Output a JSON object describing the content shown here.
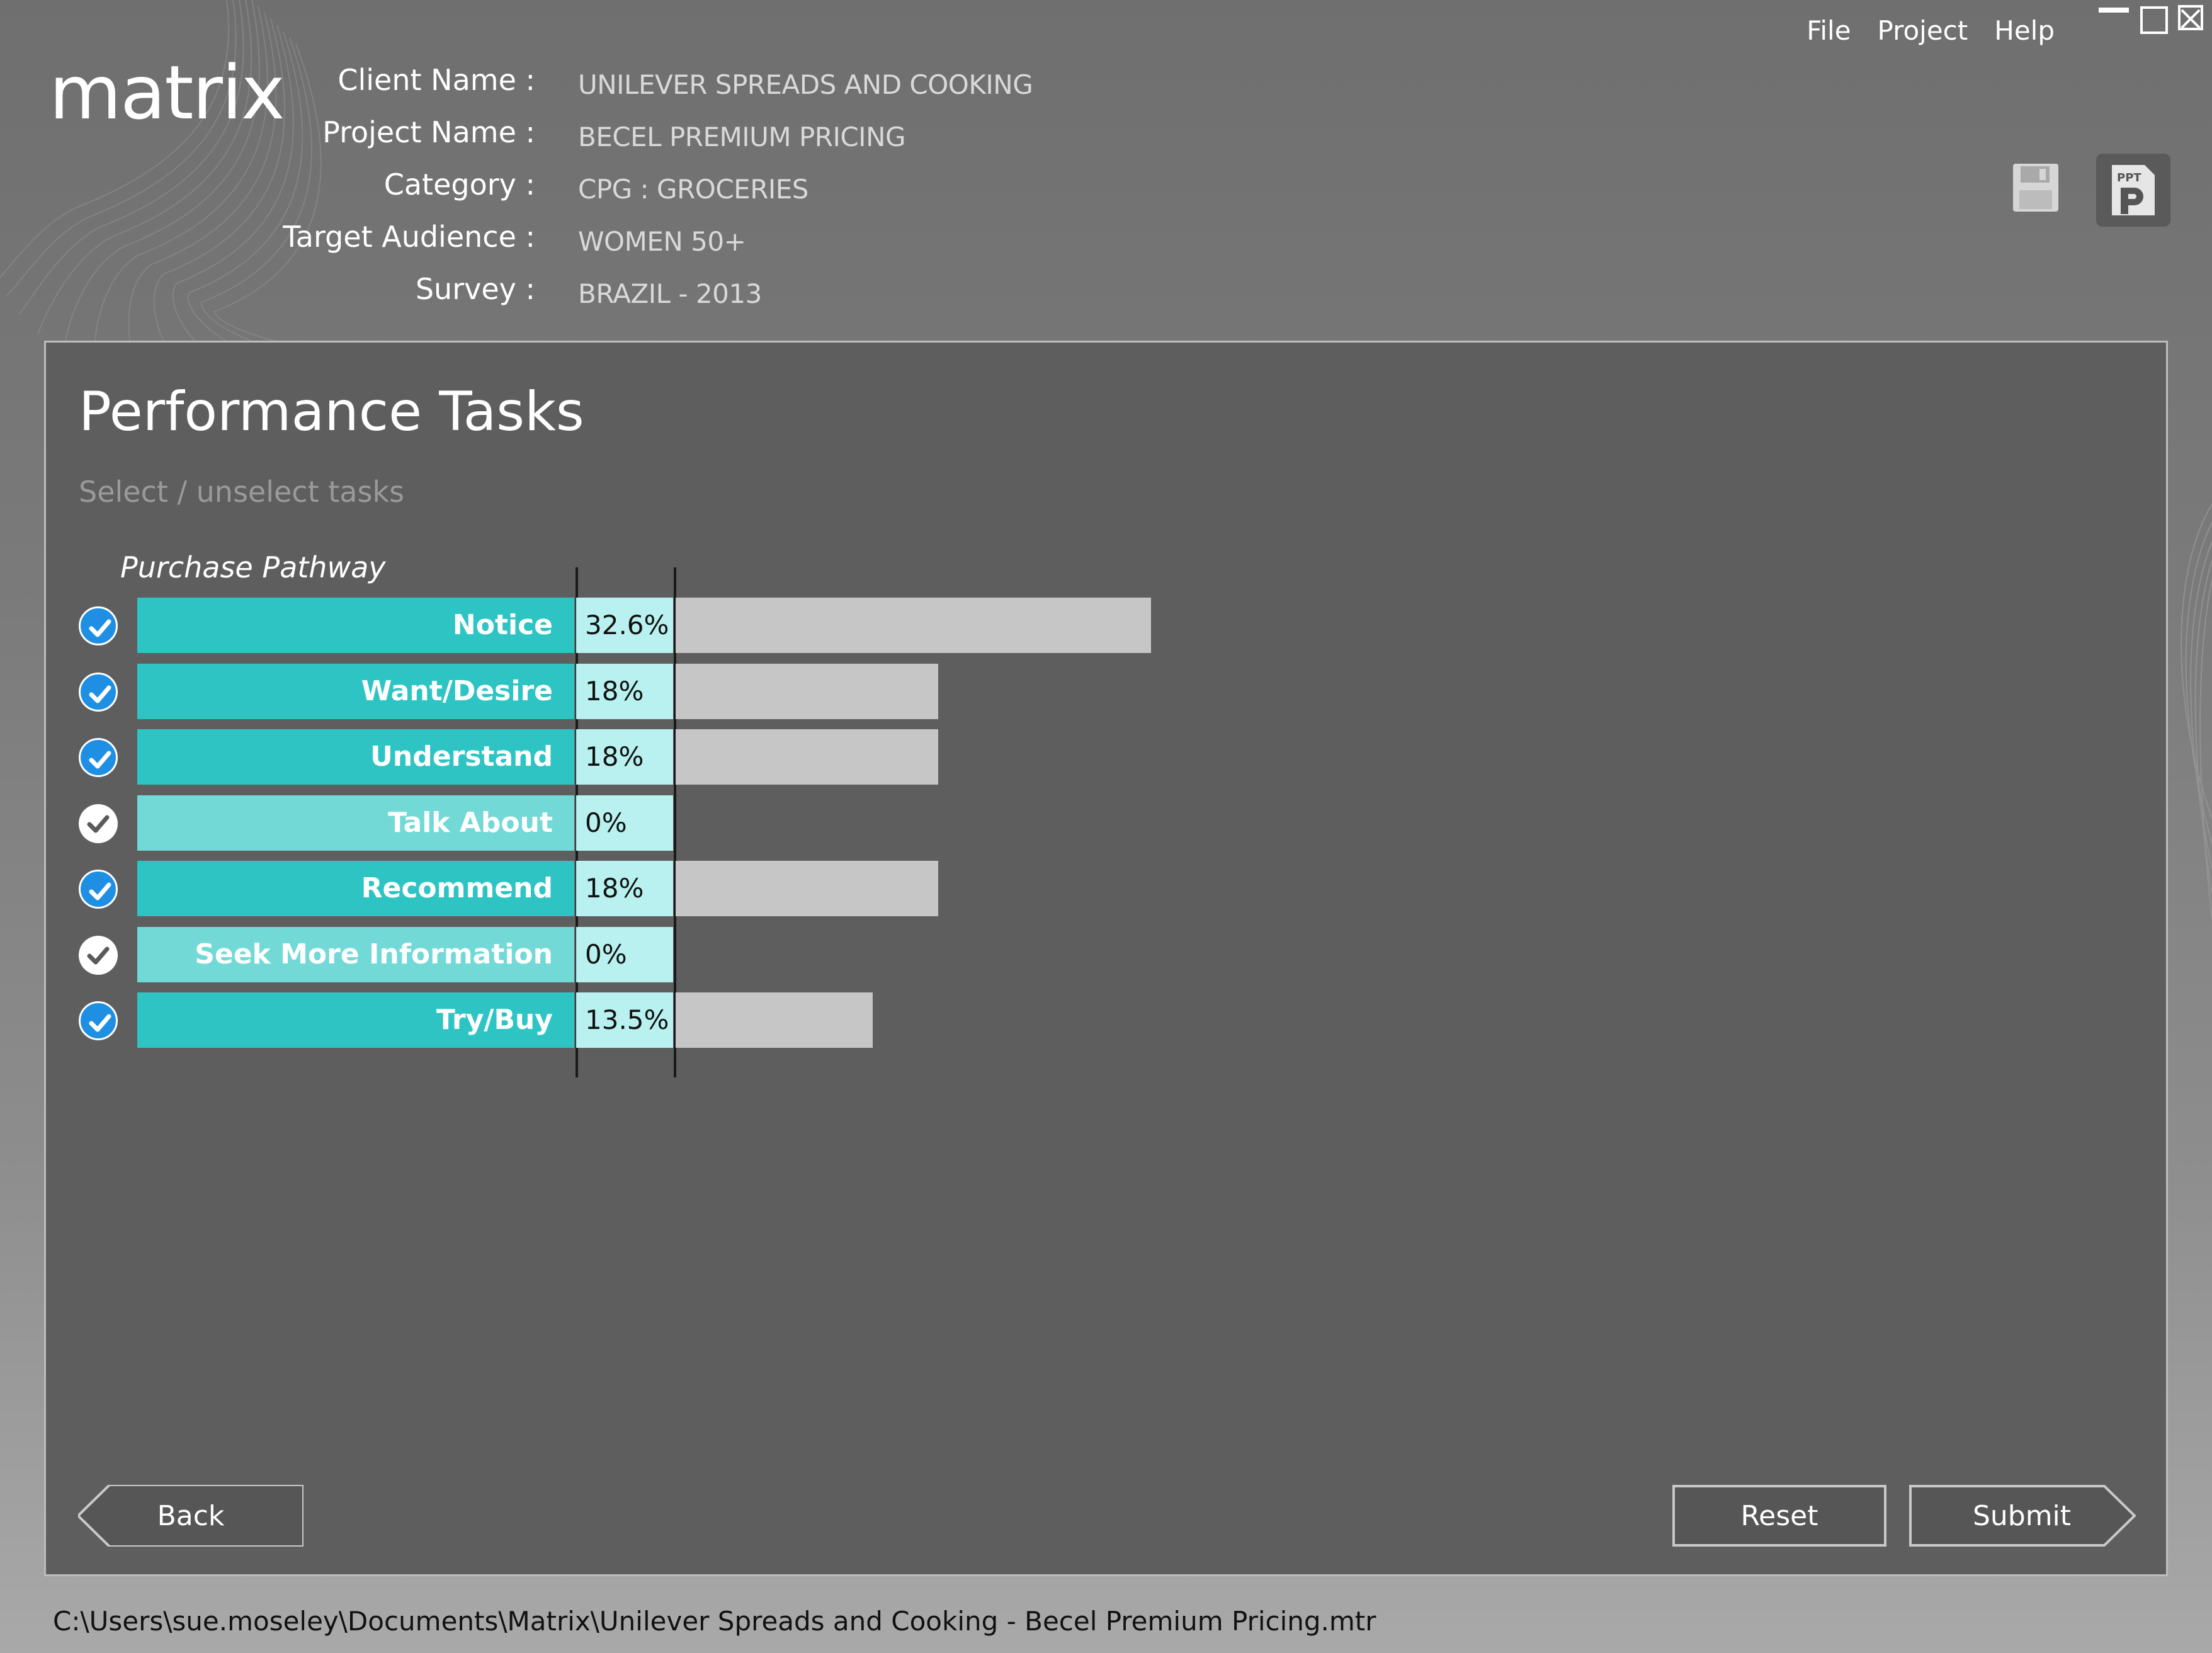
{
  "app": {
    "logo": "matrix"
  },
  "menu": {
    "file": "File",
    "project": "Project",
    "help": "Help"
  },
  "info": [
    {
      "label": "Client Name :",
      "value": "UNILEVER SPREADS AND COOKING"
    },
    {
      "label": "Project Name :",
      "value": "BECEL PREMIUM PRICING"
    },
    {
      "label": "Category :",
      "value": "CPG : GROCERIES"
    },
    {
      "label": "Target Audience :",
      "value": "WOMEN 50+"
    },
    {
      "label": "Survey :",
      "value": "BRAZIL - 2013"
    }
  ],
  "panel": {
    "title": "Performance Tasks",
    "subtitle": "Select / unselect tasks",
    "group": "Purchase Pathway"
  },
  "tasks": [
    {
      "label": "Notice",
      "pct": "32.6%",
      "value": 32.6,
      "selected": true
    },
    {
      "label": "Want/Desire",
      "pct": "18%",
      "value": 18,
      "selected": true
    },
    {
      "label": "Understand",
      "pct": "18%",
      "value": 18,
      "selected": true
    },
    {
      "label": "Talk About",
      "pct": "0%",
      "value": 0,
      "selected": false
    },
    {
      "label": "Recommend",
      "pct": "18%",
      "value": 18,
      "selected": true
    },
    {
      "label": "Seek More Information",
      "pct": "0%",
      "value": 0,
      "selected": false
    },
    {
      "label": "Try/Buy",
      "pct": "13.5%",
      "value": 13.5,
      "selected": true
    }
  ],
  "buttons": {
    "back": "Back",
    "reset": "Reset",
    "submit": "Submit"
  },
  "status": {
    "path": "C:\\Users\\sue.moseley\\Documents\\Matrix\\Unilever Spreads and Cooking - Becel Premium Pricing.mtr"
  },
  "colors": {
    "selected_label": "#2fc4c4",
    "unselected_label": "#72d9d7",
    "pct_cell": "#b9f1f1",
    "bar": "#c6c6c6",
    "check_on": "#1f8fe4"
  }
}
